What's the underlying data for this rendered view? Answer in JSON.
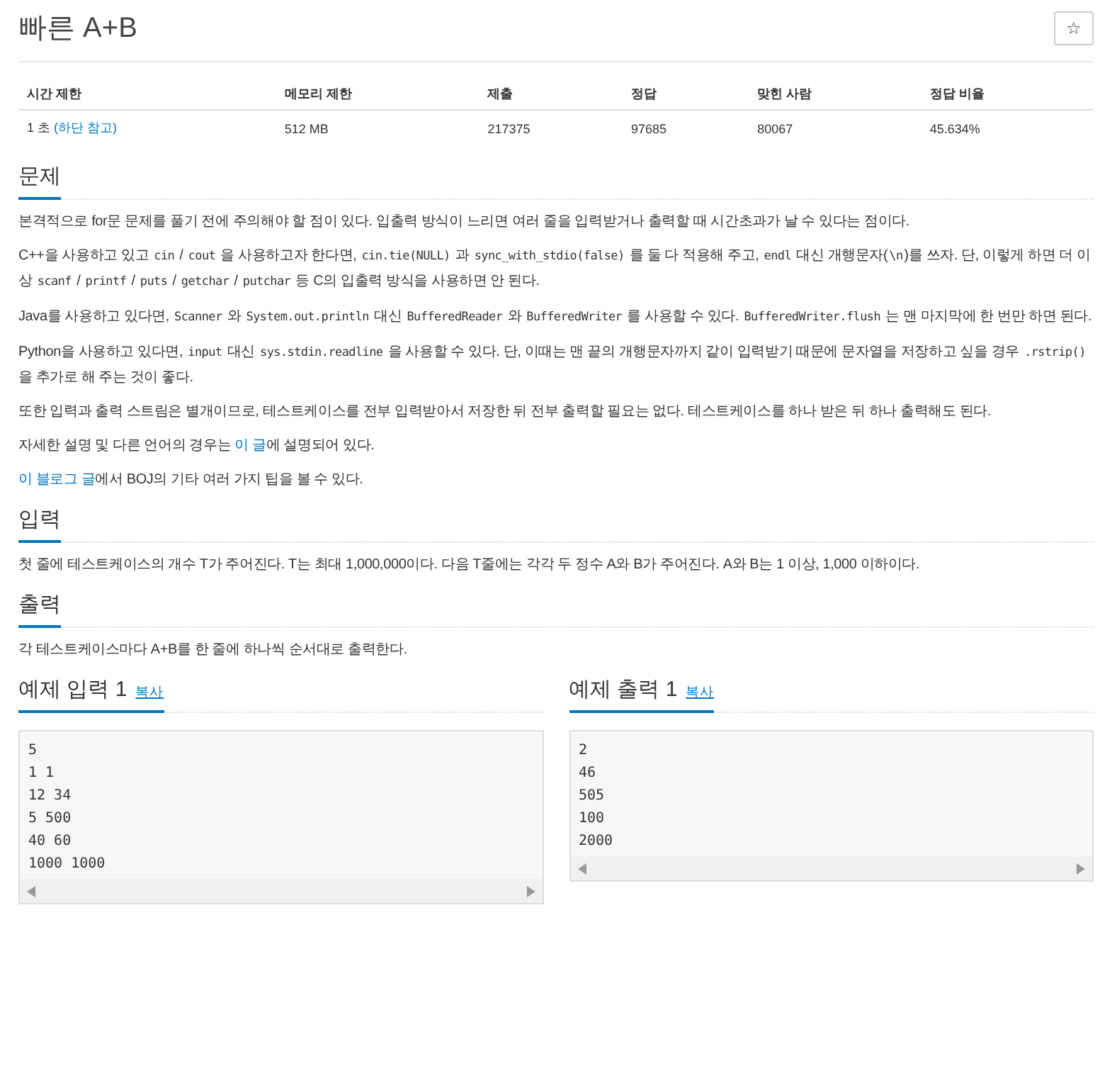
{
  "title": "빠른 A+B",
  "star_button": {
    "label": "☆"
  },
  "stats": {
    "columns": [
      "시간 제한",
      "메모리 제한",
      "제출",
      "정답",
      "맞힌 사람",
      "정답 비율"
    ],
    "row": [
      [
        {
          "kind": "text",
          "text": "1 초 "
        },
        {
          "kind": "link",
          "text": "(하단 참고)"
        }
      ],
      [
        {
          "kind": "text",
          "text": "512 MB"
        }
      ],
      [
        {
          "kind": "text",
          "text": "217375"
        }
      ],
      [
        {
          "kind": "text",
          "text": "97685"
        }
      ],
      [
        {
          "kind": "text",
          "text": "80067"
        }
      ],
      [
        {
          "kind": "text",
          "text": "45.634%"
        }
      ]
    ]
  },
  "sections": [
    {
      "heading": "문제",
      "paragraphs": [
        [
          {
            "kind": "text",
            "text": "본격적으로 for문 문제를 풀기 전에 주의해야 할 점이 있다. 입출력 방식이 느리면 여러 줄을 입력받거나 출력할 때 시간초과가 날 수 있다는 점이다."
          }
        ],
        [
          {
            "kind": "text",
            "text": "C++을 사용하고 있고 "
          },
          {
            "kind": "code",
            "text": "cin"
          },
          {
            "kind": "text",
            "text": " / "
          },
          {
            "kind": "code",
            "text": "cout"
          },
          {
            "kind": "text",
            "text": " 을 사용하고자 한다면, "
          },
          {
            "kind": "code",
            "text": "cin.tie(NULL)"
          },
          {
            "kind": "text",
            "text": " 과 "
          },
          {
            "kind": "code",
            "text": "sync_with_stdio(false)"
          },
          {
            "kind": "text",
            "text": " 를 둘 다 적용해 주고, "
          },
          {
            "kind": "code",
            "text": "endl"
          },
          {
            "kind": "text",
            "text": " 대신 개행문자("
          },
          {
            "kind": "code",
            "text": "\\n"
          },
          {
            "kind": "text",
            "text": ")를 쓰자. 단, 이렇게 하면 더 이상 "
          },
          {
            "kind": "code",
            "text": "scanf"
          },
          {
            "kind": "text",
            "text": " / "
          },
          {
            "kind": "code",
            "text": "printf"
          },
          {
            "kind": "text",
            "text": " / "
          },
          {
            "kind": "code",
            "text": "puts"
          },
          {
            "kind": "text",
            "text": " / "
          },
          {
            "kind": "code",
            "text": "getchar"
          },
          {
            "kind": "text",
            "text": " / "
          },
          {
            "kind": "code",
            "text": "putchar"
          },
          {
            "kind": "text",
            "text": " 등 C의 입출력 방식을 사용하면 안 된다."
          }
        ],
        [
          {
            "kind": "text",
            "text": "Java를 사용하고 있다면, "
          },
          {
            "kind": "code",
            "text": "Scanner"
          },
          {
            "kind": "text",
            "text": " 와 "
          },
          {
            "kind": "code",
            "text": "System.out.println"
          },
          {
            "kind": "text",
            "text": " 대신 "
          },
          {
            "kind": "code",
            "text": "BufferedReader"
          },
          {
            "kind": "text",
            "text": " 와 "
          },
          {
            "kind": "code",
            "text": "BufferedWriter"
          },
          {
            "kind": "text",
            "text": " 를 사용할 수 있다. "
          },
          {
            "kind": "code",
            "text": "BufferedWriter.flush"
          },
          {
            "kind": "text",
            "text": " 는 맨 마지막에 한 번만 하면 된다."
          }
        ],
        [
          {
            "kind": "text",
            "text": "Python을 사용하고 있다면, "
          },
          {
            "kind": "code",
            "text": "input"
          },
          {
            "kind": "text",
            "text": " 대신 "
          },
          {
            "kind": "code",
            "text": "sys.stdin.readline"
          },
          {
            "kind": "text",
            "text": " 을 사용할 수 있다. 단, 이때는 맨 끝의 개행문자까지 같이 입력받기 때문에 문자열을 저장하고 싶을 경우 "
          },
          {
            "kind": "code",
            "text": ".rstrip()"
          },
          {
            "kind": "text",
            "text": " 을 추가로 해 주는 것이 좋다."
          }
        ],
        [
          {
            "kind": "text",
            "text": "또한 입력과 출력 스트림은 별개이므로, 테스트케이스를 전부 입력받아서 저장한 뒤 전부 출력할 필요는 없다. 테스트케이스를 하나 받은 뒤 하나 출력해도 된다."
          }
        ],
        [
          {
            "kind": "text",
            "text": "자세한 설명 및 다른 언어의 경우는 "
          },
          {
            "kind": "link",
            "text": "이 글"
          },
          {
            "kind": "text",
            "text": "에 설명되어 있다."
          }
        ],
        [
          {
            "kind": "link",
            "text": "이 블로그 글"
          },
          {
            "kind": "text",
            "text": "에서 BOJ의 기타 여러 가지 팁을 볼 수 있다."
          }
        ]
      ]
    },
    {
      "heading": "입력",
      "paragraphs": [
        [
          {
            "kind": "text",
            "text": "첫 줄에 테스트케이스의 개수 T가 주어진다. T는 최대 1,000,000이다. 다음 T줄에는 각각 두 정수 A와 B가 주어진다. A와 B는 1 이상, 1,000 이하이다."
          }
        ]
      ]
    },
    {
      "heading": "출력",
      "paragraphs": [
        [
          {
            "kind": "text",
            "text": "각 테스트케이스마다 A+B를 한 줄에 하나씩 순서대로 출력한다."
          }
        ]
      ]
    }
  ],
  "samples": [
    {
      "heading": "예제 입력 1",
      "copy": "복사",
      "lines": [
        "5",
        "1 1",
        "12 34",
        "5 500",
        "40 60",
        "1000 1000"
      ]
    },
    {
      "heading": "예제 출력 1",
      "copy": "복사",
      "lines": [
        "2",
        "46",
        "505",
        "100",
        "2000"
      ]
    }
  ]
}
